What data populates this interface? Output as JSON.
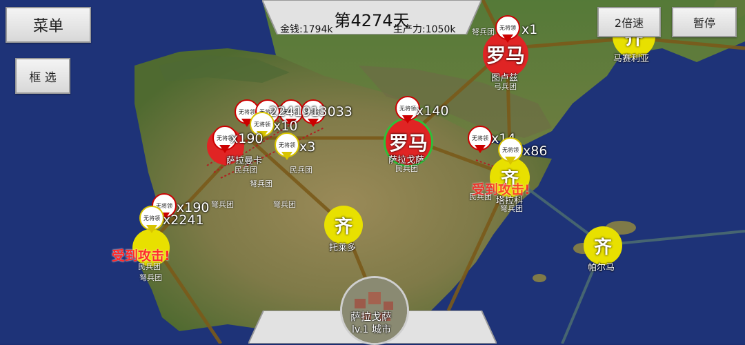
{
  "ui": {
    "menu_label": "菜单",
    "select_label": "框 选",
    "speed_label": "2倍速",
    "pause_label": "暂停",
    "day_text": "第4274天",
    "money_text": "金钱:1794k",
    "production_text": "生产力:1050k"
  },
  "city_panel": {
    "name": "萨拉戈萨",
    "level_text": "lv.1 城市"
  },
  "factions": {
    "rome": {
      "name": "罗马",
      "color": "#e02424"
    },
    "qi": {
      "name": "齐",
      "color": "#e8e000"
    }
  },
  "cities": {
    "toulouse": {
      "glyph": "罗马",
      "name": "图卢兹",
      "unit": "弓兵团"
    },
    "zaragoza": {
      "glyph": "罗马",
      "name": "萨拉戈萨",
      "unit": "民兵团"
    },
    "marseille": {
      "glyph": "齐",
      "name": "马赛利亚"
    },
    "tarraco": {
      "glyph": "齐",
      "name": "塔拉科",
      "unit1": "民兵团",
      "unit2": "弩兵团"
    },
    "toledo": {
      "glyph": "齐",
      "name": "托莱多"
    },
    "mallorca": {
      "glyph": "齐",
      "name": "帕尔马"
    },
    "salamanca": {
      "name": "萨拉曼卡"
    }
  },
  "armies": {
    "general_none": "无将领",
    "toulouse_count": "x1",
    "zaragoza_count": "x140",
    "tarraco_count_a": "x14",
    "tarraco_count_b": "x86",
    "center_count_a": "x10",
    "center_count_b": "x3",
    "cluster_counts": "2241913033",
    "west_count": "x190",
    "west_counts2": "x2213",
    "west_counts3": "x190",
    "west_counts4": "x2241"
  },
  "unit_labels": {
    "militia": "民兵团",
    "crossbow": "弩兵团",
    "crossbow2": "弩兵团",
    "west_unit1": "民兵团",
    "west_unit2": "弩兵团",
    "north_unit": "弩兵团",
    "mid_unit1": "民兵团",
    "mid_unit2": "弩兵团"
  },
  "alerts": {
    "attacked_east": "受到攻击!",
    "attacked_west": "受到攻击!"
  }
}
